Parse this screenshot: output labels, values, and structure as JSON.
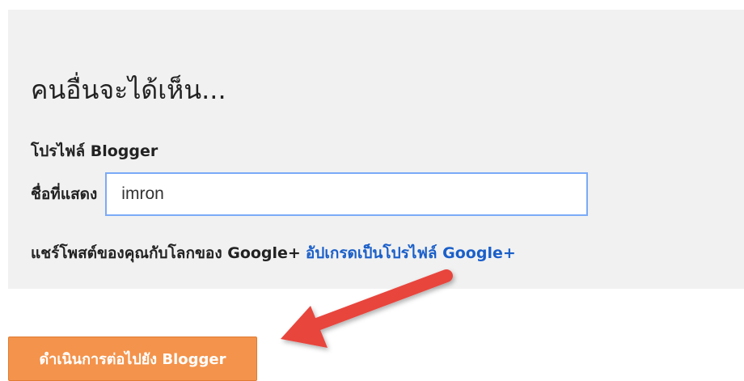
{
  "panel": {
    "heading": "คนอื่นจะได้เห็น...",
    "section_label": "โปรไฟล์ Blogger",
    "display_name": {
      "label": "ชื่อที่แสดง",
      "value": "imron"
    },
    "share": {
      "text": "แชร์โพสต์ของคุณกับโลกของ Google+",
      "link": "อัปเกรดเป็นโปรไฟล์ Google+"
    }
  },
  "actions": {
    "continue_label": "ดำเนินการต่อไปยัง Blogger"
  },
  "annotation": {
    "icon": "red-arrow-icon",
    "color": "#e8453c"
  },
  "colors": {
    "link": "#1a5fc9",
    "button": "#f4934b",
    "input_border": "#7baaf7",
    "panel_bg": "#f1f1f1"
  }
}
